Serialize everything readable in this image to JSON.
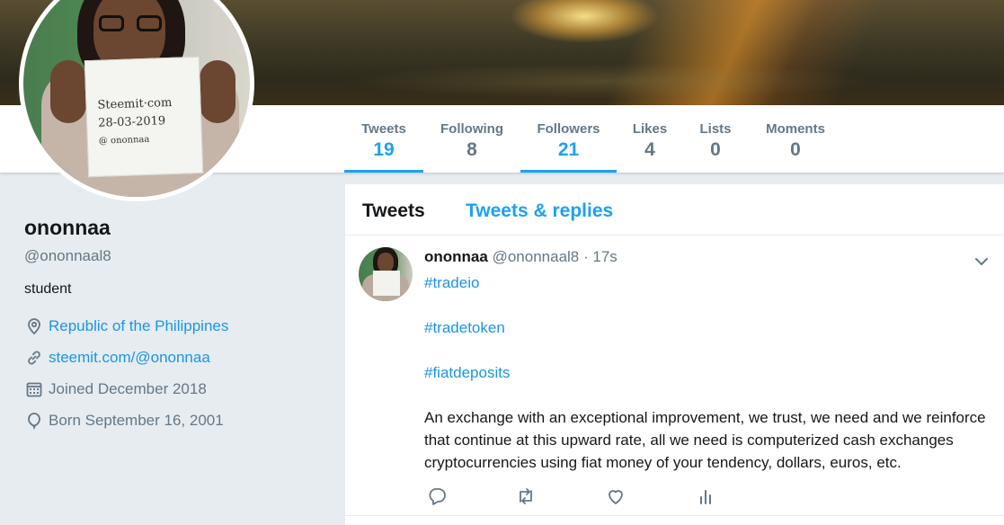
{
  "profile": {
    "name": "ononnaa",
    "handle": "@ononnaal8",
    "bio": "student",
    "location": "Republic of the Philippines",
    "website": "steemit.com/@ononnaa",
    "joined": "Joined December 2018",
    "born": "Born September 16, 2001"
  },
  "avatar_sign": {
    "line1": "Steemit·com",
    "line2": "28-03-2019",
    "line3": "@ ononnaa"
  },
  "nav": [
    {
      "label": "Tweets",
      "value": "19"
    },
    {
      "label": "Following",
      "value": "8"
    },
    {
      "label": "Followers",
      "value": "21"
    },
    {
      "label": "Likes",
      "value": "4"
    },
    {
      "label": "Lists",
      "value": "0"
    },
    {
      "label": "Moments",
      "value": "0"
    }
  ],
  "tabs": {
    "tweets": "Tweets",
    "replies": "Tweets & replies"
  },
  "tweet": {
    "name": "ononnaa",
    "handle": "@ononnaal8",
    "time": "· 17s",
    "hashtags": [
      "#tradeio",
      "#tradetoken",
      "#fiatdeposits"
    ],
    "text": "An exchange with an exceptional improvement, we trust, we need and we reinforce that continue at this upward rate, all we need is computerized cash exchanges cryptocurrencies using fiat money of your tendency, dollars, euros, etc."
  },
  "colors": {
    "accent": "#1da1f2",
    "link": "#1b95e0",
    "muted": "#657786",
    "background": "#e6ecf0"
  },
  "icons": [
    "location-icon",
    "link-icon",
    "calendar-icon",
    "balloon-icon",
    "chevron-down-icon",
    "reply-icon",
    "retweet-icon",
    "like-icon",
    "analytics-icon"
  ]
}
